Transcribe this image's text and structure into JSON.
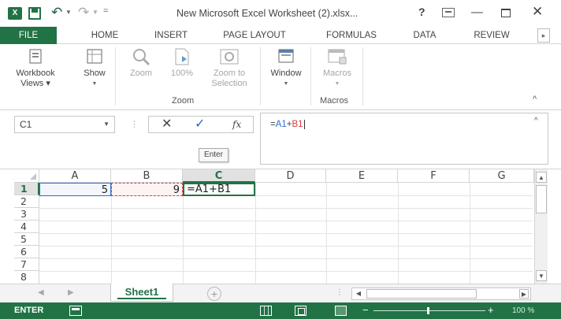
{
  "titlebar": {
    "app_icon": "X",
    "window_title": "New Microsoft Excel Worksheet (2).xlsx...",
    "help": "?"
  },
  "tabs": [
    {
      "label": "FILE",
      "active": true
    },
    {
      "label": "HOME"
    },
    {
      "label": "INSERT"
    },
    {
      "label": "PAGE LAYOUT"
    },
    {
      "label": "FORMULAS"
    },
    {
      "label": "DATA"
    },
    {
      "label": "REVIEW"
    }
  ],
  "ribbon": {
    "workbook_views": "Workbook Views ▾",
    "show": "Show",
    "zoom": "Zoom",
    "zoom_100": "100%",
    "zoom_to_selection": "Zoom to Selection",
    "window": "Window",
    "macros": "Macros",
    "group_zoom": "Zoom",
    "group_macros": "Macros"
  },
  "formula_bar": {
    "name_box": "C1",
    "tooltip": "Enter",
    "formula_prefix": "=",
    "ref_a": "A1",
    "operator": "+",
    "ref_b": "B1"
  },
  "grid": {
    "columns": [
      "A",
      "B",
      "C",
      "D",
      "E",
      "F",
      "G"
    ],
    "rows": [
      "1",
      "2",
      "3",
      "4",
      "5",
      "6",
      "7",
      "8"
    ],
    "cells": {
      "A1": "5",
      "B1": "9",
      "C1": "=A1+B1"
    },
    "active_cell": "C1"
  },
  "sheets": {
    "active": "Sheet1"
  },
  "status": {
    "mode": "ENTER",
    "zoom": "100 %"
  },
  "colors": {
    "brand": "#217346",
    "ref_a": "#2f6bd1",
    "ref_b": "#d83b3b"
  }
}
